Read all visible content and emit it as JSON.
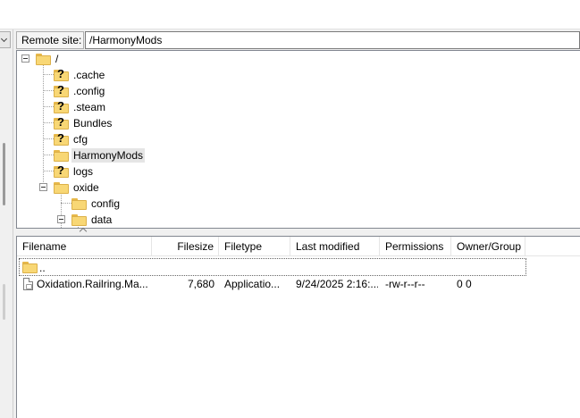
{
  "remote_site": {
    "label": "Remote site:",
    "path": "/HarmonyMods"
  },
  "tree": {
    "root": "/",
    "items": [
      {
        "label": ".cache",
        "icon": "unknown-folder-icon"
      },
      {
        "label": ".config",
        "icon": "unknown-folder-icon"
      },
      {
        "label": ".steam",
        "icon": "unknown-folder-icon"
      },
      {
        "label": "Bundles",
        "icon": "unknown-folder-icon"
      },
      {
        "label": "cfg",
        "icon": "unknown-folder-icon"
      },
      {
        "label": "HarmonyMods",
        "icon": "folder-icon",
        "selected": true
      },
      {
        "label": "logs",
        "icon": "unknown-folder-icon"
      },
      {
        "label": "oxide",
        "icon": "folder-icon",
        "expanded": true
      }
    ],
    "oxide_children": [
      {
        "label": "config",
        "icon": "folder-icon"
      },
      {
        "label": "data",
        "icon": "folder-icon",
        "expanded": true
      }
    ]
  },
  "file_list": {
    "columns": [
      "Filename",
      "Filesize",
      "Filetype",
      "Last modified",
      "Permissions",
      "Owner/Group"
    ],
    "parent_entry": "..",
    "rows": [
      {
        "filename": "Oxidation.Railring.Ma...",
        "filesize": "7,680",
        "filetype": "Applicatio...",
        "last_modified": "9/24/2025 2:16:...",
        "permissions": "-rw-r--r--",
        "owner_group": "0 0"
      }
    ]
  },
  "colors": {
    "folder": "#f8d775",
    "selection": "#e5e5e5",
    "border": "#828790"
  }
}
